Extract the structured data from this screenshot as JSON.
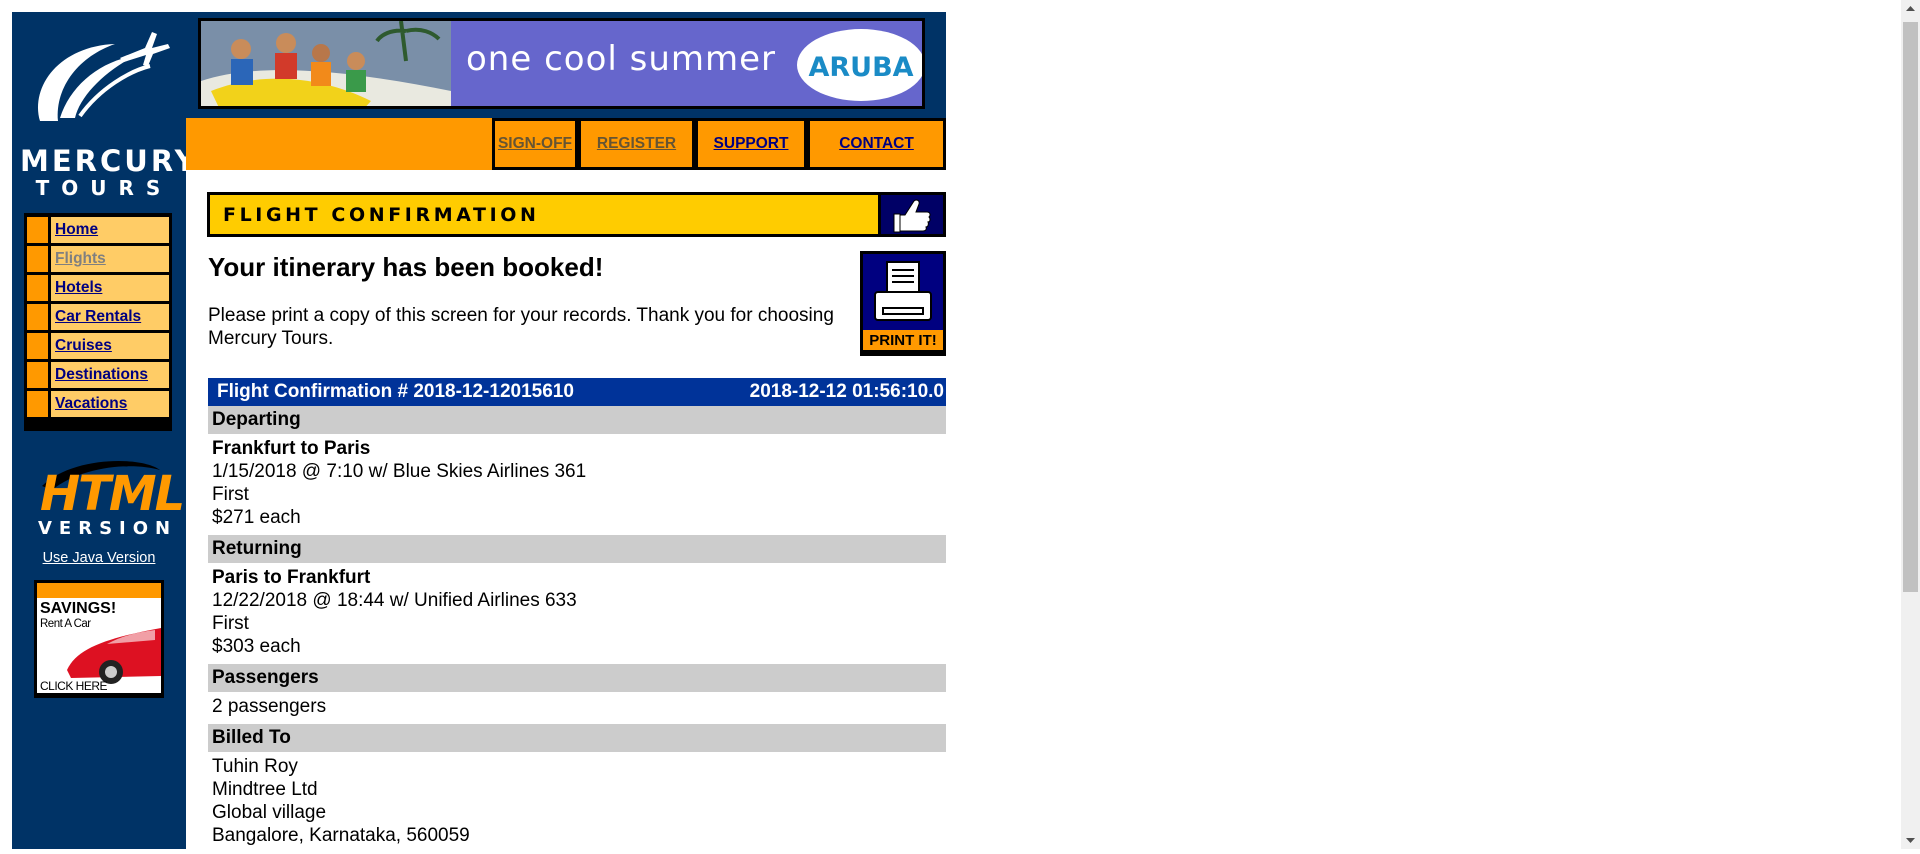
{
  "logo": {
    "word1": "MERCURY",
    "word2": "TOURS"
  },
  "nav": [
    {
      "label": "Home"
    },
    {
      "label": "Flights"
    },
    {
      "label": "Hotels"
    },
    {
      "label": "Car Rentals"
    },
    {
      "label": "Cruises"
    },
    {
      "label": "Destinations"
    },
    {
      "label": "Vacations"
    }
  ],
  "html_badge": {
    "line1": "HTML",
    "line2": "VERSION"
  },
  "java_link": "Use Java Version",
  "savings_ad": {
    "headline": "SAVINGS!",
    "sub": "Rent A Car",
    "cta": "CLICK HERE"
  },
  "banner": {
    "slogan": "one cool summer",
    "brand": "ARUBA"
  },
  "top_menu": [
    {
      "label": "SIGN-OFF"
    },
    {
      "label": "REGISTER"
    },
    {
      "label": "SUPPORT"
    },
    {
      "label": "CONTACT"
    }
  ],
  "header": {
    "title": "FLIGHT CONFIRMATION",
    "icon": "thumbs-up-icon"
  },
  "booked": {
    "title": "Your itinerary has been booked!",
    "note": "Please print a copy of this screen for your records. Thank you for choosing Mercury Tours.",
    "print_label": "PRINT IT!"
  },
  "confirmation": {
    "number": "Flight Confirmation # 2018-12-12015610",
    "timestamp": "2018-12-12 01:56:10.0"
  },
  "departing": {
    "heading": "Departing",
    "route": "Frankfurt to Paris",
    "flight": "1/15/2018 @ 7:10 w/ Blue Skies Airlines 361",
    "class": "First",
    "price": "$271 each"
  },
  "returning": {
    "heading": "Returning",
    "route": "Paris to Frankfurt",
    "flight": "12/22/2018 @ 18:44 w/ Unified Airlines 633",
    "class": "First",
    "price": "$303 each"
  },
  "passengers": {
    "heading": "Passengers",
    "value": "2 passengers"
  },
  "billed_to": {
    "heading": "Billed To",
    "name": "Tuhin Roy",
    "company": "Mindtree Ltd",
    "address": "Global village",
    "city": "Bangalore, Karnataka, 560059"
  },
  "colors": {
    "navy": "#003366",
    "orange": "#ff9900",
    "gold": "#ffcc00",
    "nav_cell": "#ffcc66",
    "conf_bar": "#003399",
    "section_gray": "#cccccc",
    "link": "#000080"
  }
}
